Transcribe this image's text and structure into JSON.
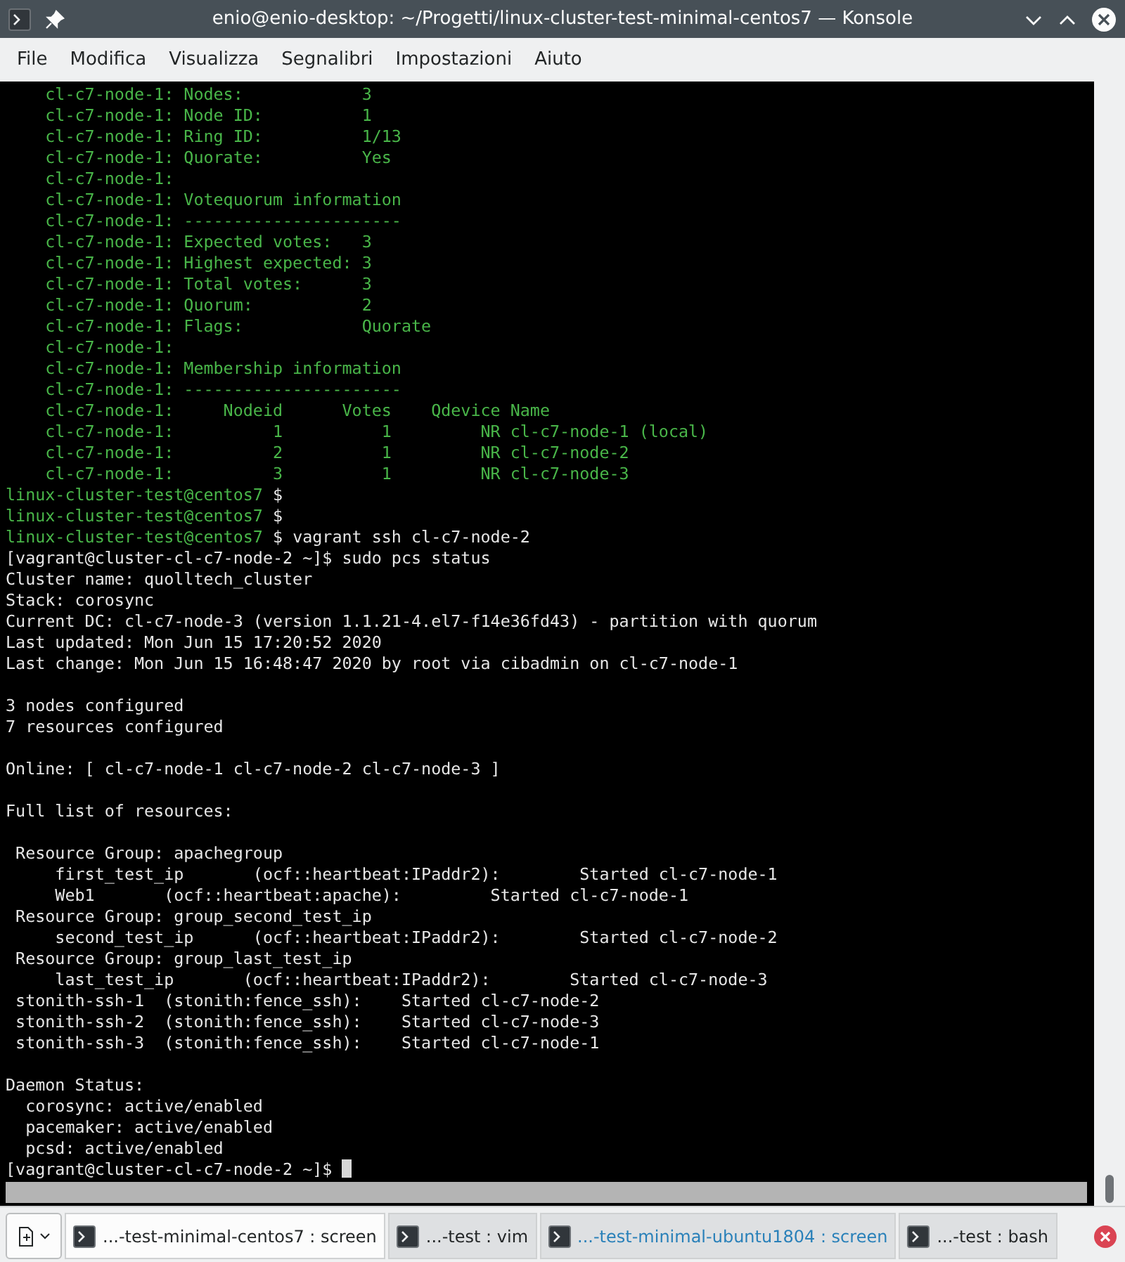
{
  "window": {
    "title": "enio@enio-desktop: ~/Progetti/linux-cluster-test-minimal-centos7 — Konsole"
  },
  "menu": [
    "File",
    "Modifica",
    "Visualizza",
    "Segnalibri",
    "Impostazioni",
    "Aiuto"
  ],
  "terminal": {
    "lines": [
      {
        "kind": "remote",
        "text": "    cl-c7-node-1: Nodes:            3"
      },
      {
        "kind": "remote",
        "text": "    cl-c7-node-1: Node ID:          1"
      },
      {
        "kind": "remote",
        "text": "    cl-c7-node-1: Ring ID:          1/13"
      },
      {
        "kind": "remote",
        "text": "    cl-c7-node-1: Quorate:          Yes"
      },
      {
        "kind": "remote",
        "text": "    cl-c7-node-1:"
      },
      {
        "kind": "remote",
        "text": "    cl-c7-node-1: Votequorum information"
      },
      {
        "kind": "remote",
        "text": "    cl-c7-node-1: ----------------------"
      },
      {
        "kind": "remote",
        "text": "    cl-c7-node-1: Expected votes:   3"
      },
      {
        "kind": "remote",
        "text": "    cl-c7-node-1: Highest expected: 3"
      },
      {
        "kind": "remote",
        "text": "    cl-c7-node-1: Total votes:      3"
      },
      {
        "kind": "remote",
        "text": "    cl-c7-node-1: Quorum:           2"
      },
      {
        "kind": "remote",
        "text": "    cl-c7-node-1: Flags:            Quorate"
      },
      {
        "kind": "remote",
        "text": "    cl-c7-node-1:"
      },
      {
        "kind": "remote",
        "text": "    cl-c7-node-1: Membership information"
      },
      {
        "kind": "remote",
        "text": "    cl-c7-node-1: ----------------------"
      },
      {
        "kind": "remote",
        "text": "    cl-c7-node-1:     Nodeid      Votes    Qdevice Name"
      },
      {
        "kind": "remote",
        "text": "    cl-c7-node-1:          1          1         NR cl-c7-node-1 (local)"
      },
      {
        "kind": "remote",
        "text": "    cl-c7-node-1:          2          1         NR cl-c7-node-2"
      },
      {
        "kind": "remote",
        "text": "    cl-c7-node-1:          3          1         NR cl-c7-node-3"
      },
      {
        "kind": "prompt",
        "prompt": "linux-cluster-test@centos7",
        "text": " $"
      },
      {
        "kind": "prompt",
        "prompt": "linux-cluster-test@centos7",
        "text": " $"
      },
      {
        "kind": "prompt",
        "prompt": "linux-cluster-test@centos7",
        "text": " $ vagrant ssh cl-c7-node-2"
      },
      {
        "kind": "output",
        "text": "[vagrant@cluster-cl-c7-node-2 ~]$ sudo pcs status"
      },
      {
        "kind": "output",
        "text": "Cluster name: quolltech_cluster"
      },
      {
        "kind": "output",
        "text": "Stack: corosync"
      },
      {
        "kind": "output",
        "text": "Current DC: cl-c7-node-3 (version 1.1.21-4.el7-f14e36fd43) - partition with quorum"
      },
      {
        "kind": "output",
        "text": "Last updated: Mon Jun 15 17:20:52 2020"
      },
      {
        "kind": "output",
        "text": "Last change: Mon Jun 15 16:48:47 2020 by root via cibadmin on cl-c7-node-1"
      },
      {
        "kind": "blank"
      },
      {
        "kind": "output",
        "text": "3 nodes configured"
      },
      {
        "kind": "output",
        "text": "7 resources configured"
      },
      {
        "kind": "blank"
      },
      {
        "kind": "output",
        "text": "Online: [ cl-c7-node-1 cl-c7-node-2 cl-c7-node-3 ]"
      },
      {
        "kind": "blank"
      },
      {
        "kind": "output",
        "text": "Full list of resources:"
      },
      {
        "kind": "blank"
      },
      {
        "kind": "output",
        "text": " Resource Group: apachegroup"
      },
      {
        "kind": "output",
        "text": "     first_test_ip       (ocf::heartbeat:IPaddr2):        Started cl-c7-node-1"
      },
      {
        "kind": "output",
        "text": "     Web1       (ocf::heartbeat:apache):         Started cl-c7-node-1"
      },
      {
        "kind": "output",
        "text": " Resource Group: group_second_test_ip"
      },
      {
        "kind": "output",
        "text": "     second_test_ip      (ocf::heartbeat:IPaddr2):        Started cl-c7-node-2"
      },
      {
        "kind": "output",
        "text": " Resource Group: group_last_test_ip"
      },
      {
        "kind": "output",
        "text": "     last_test_ip       (ocf::heartbeat:IPaddr2):        Started cl-c7-node-3"
      },
      {
        "kind": "output",
        "text": " stonith-ssh-1  (stonith:fence_ssh):    Started cl-c7-node-2"
      },
      {
        "kind": "output",
        "text": " stonith-ssh-2  (stonith:fence_ssh):    Started cl-c7-node-3"
      },
      {
        "kind": "output",
        "text": " stonith-ssh-3  (stonith:fence_ssh):    Started cl-c7-node-1"
      },
      {
        "kind": "blank"
      },
      {
        "kind": "output",
        "text": "Daemon Status:"
      },
      {
        "kind": "output",
        "text": "  corosync: active/enabled"
      },
      {
        "kind": "output",
        "text": "  pacemaker: active/enabled"
      },
      {
        "kind": "output",
        "text": "  pcsd: active/enabled"
      },
      {
        "kind": "input",
        "text": "[vagrant@cluster-cl-c7-node-2 ~]$"
      }
    ]
  },
  "tabs": [
    {
      "label": "...-test-minimal-centos7 : screen",
      "selected": true,
      "activity": false
    },
    {
      "label": "...-test : vim",
      "selected": false,
      "activity": false
    },
    {
      "label": "...-test-minimal-ubuntu1804 : screen",
      "selected": false,
      "activity": true
    },
    {
      "label": "...-test : bash",
      "selected": false,
      "activity": false
    }
  ]
}
